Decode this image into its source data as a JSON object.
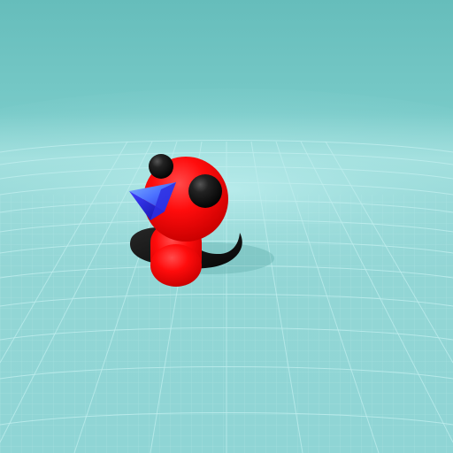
{
  "scene": {
    "background_top": "#72c6c3",
    "horizon_glow": "#a7e2e0",
    "floor_color": "#9ad9d8",
    "grid_color": "#c9efef",
    "shadow_color": "#67b4b1"
  },
  "character": {
    "body_color": "#ff0a0a",
    "eye_color": "#171717",
    "tail_color": "#121212",
    "beak_color_light": "#5a8cff",
    "beak_color_dark": "#1818b7",
    "beak_color_mid": "#3d3dff"
  }
}
